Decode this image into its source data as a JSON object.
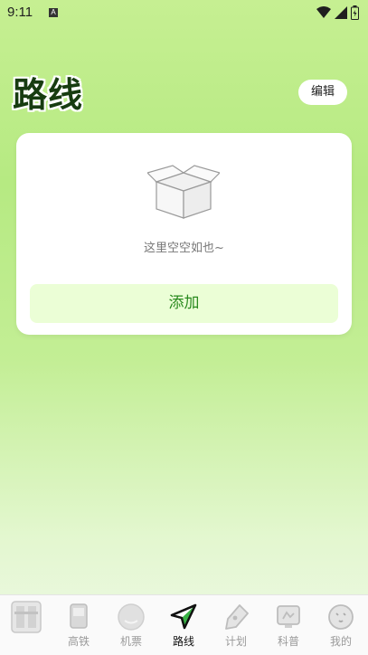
{
  "status": {
    "time": "9:11",
    "a_badge": "A"
  },
  "header": {
    "title": "路线",
    "edit_label": "编辑"
  },
  "card": {
    "empty_text": "这里空空如也~",
    "add_label": "添加"
  },
  "nav": {
    "items": [
      {
        "label": "",
        "icon": "app-logo-icon"
      },
      {
        "label": "高铁",
        "icon": "train-icon"
      },
      {
        "label": "机票",
        "icon": "plane-ticket-icon"
      },
      {
        "label": "路线",
        "icon": "route-arrow-icon",
        "active": true
      },
      {
        "label": "计划",
        "icon": "pen-icon"
      },
      {
        "label": "科普",
        "icon": "science-icon"
      },
      {
        "label": "我的",
        "icon": "profile-icon"
      }
    ]
  },
  "colors": {
    "accent": "#2a8a1f",
    "title": "#173c10",
    "add_bg": "#ebfed6"
  }
}
